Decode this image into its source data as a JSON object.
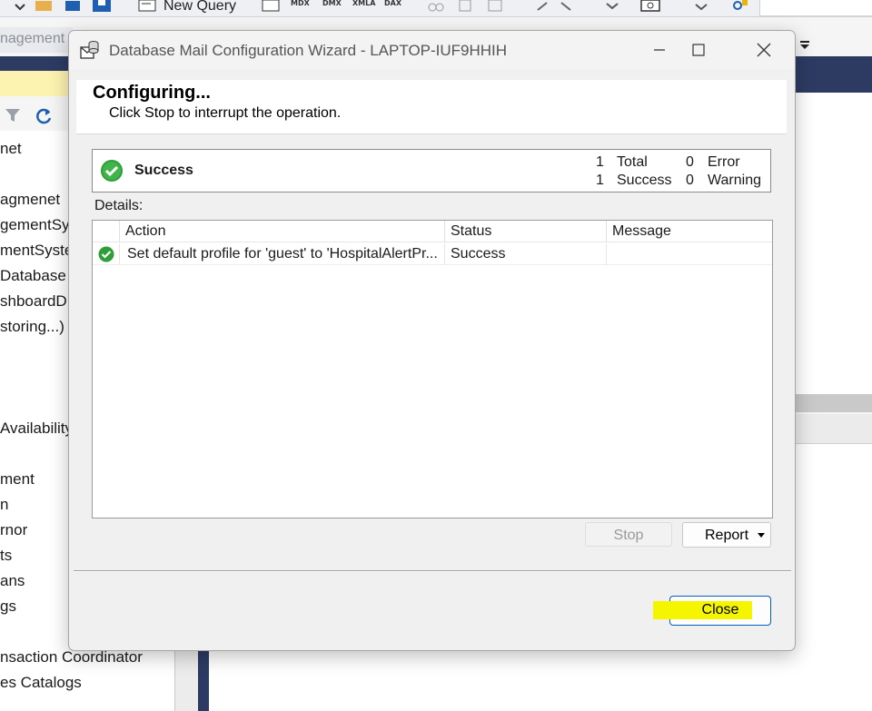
{
  "toolbar": {
    "new_query_label": "New Query",
    "mdx": "MDX",
    "dmx": "DMX",
    "xmla": "XMLA",
    "dax": "DAX"
  },
  "background": {
    "tab_fragment": "nagement",
    "tree_items": [
      "net",
      "agmenet",
      "gementSys",
      "mentSyste",
      "Database",
      "shboardD",
      "storing...)",
      "Availability",
      "ment",
      "n",
      "rnor",
      "ts",
      "ans",
      "gs",
      "nsaction Coordinator",
      "es Catalogs"
    ]
  },
  "dialog": {
    "title": "Database Mail Configuration Wizard - LAPTOP-IUF9HHIH",
    "header_title": "Configuring...",
    "header_subtitle": "Click Stop to interrupt the operation.",
    "summary": {
      "status": "Success",
      "stats": [
        {
          "count": "1",
          "label": "Total"
        },
        {
          "count": "1",
          "label": "Success"
        },
        {
          "count": "0",
          "label": "Error"
        },
        {
          "count": "0",
          "label": "Warning"
        }
      ]
    },
    "details_label": "Details:",
    "grid": {
      "columns": [
        "Action",
        "Status",
        "Message"
      ],
      "rows": [
        {
          "action": "Set default profile for 'guest' to 'HospitalAlertPr...",
          "status": "Success",
          "message": ""
        }
      ]
    },
    "stop_label": "Stop",
    "report_label": "Report",
    "close_label": "Close"
  },
  "colors": {
    "accent": "#005fb8",
    "highlight": "#f5f500",
    "success": "#2e9e3a",
    "ide_dark": "#2d3b63"
  }
}
